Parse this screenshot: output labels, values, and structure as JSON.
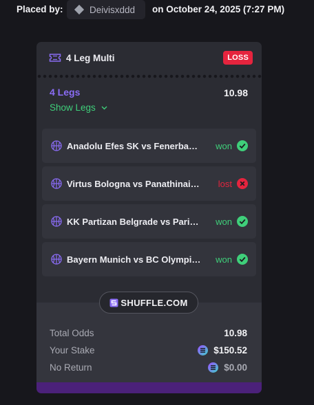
{
  "header": {
    "placed_by_label": "Placed by:",
    "username": "Deivisxddd",
    "date_text": "on October 24, 2025 (7:27 PM)",
    "user_icon": "diamond-icon"
  },
  "bet": {
    "title": "4 Leg Multi",
    "status_badge": "LOSS",
    "legs_count_label": "4 Legs",
    "odds": "10.98",
    "show_legs_label": "Show Legs",
    "legs": [
      {
        "name": "Anadolu Efes SK vs Fenerbahçe",
        "status": "won",
        "icon": "check-icon"
      },
      {
        "name": "Virtus Bologna vs Panathinaikos",
        "status": "lost",
        "icon": "x-icon"
      },
      {
        "name": "KK Partizan Belgrade vs Paris Basketball",
        "status": "won",
        "icon": "check-icon"
      },
      {
        "name": "Bayern Munich vs BC Olympiacos",
        "status": "won",
        "icon": "check-icon"
      }
    ]
  },
  "brand": {
    "label": "SHUFFLE.COM"
  },
  "summary": {
    "total_odds_label": "Total Odds",
    "total_odds_value": "10.98",
    "stake_label": "Your Stake",
    "stake_value": "$150.52",
    "return_label": "No Return",
    "return_value": "$0.00"
  },
  "colors": {
    "accent_purple": "#8a6cf5",
    "won_green": "#3fcf7a",
    "loss_red": "#e5243e",
    "bottom_bar": "#4b217a"
  }
}
